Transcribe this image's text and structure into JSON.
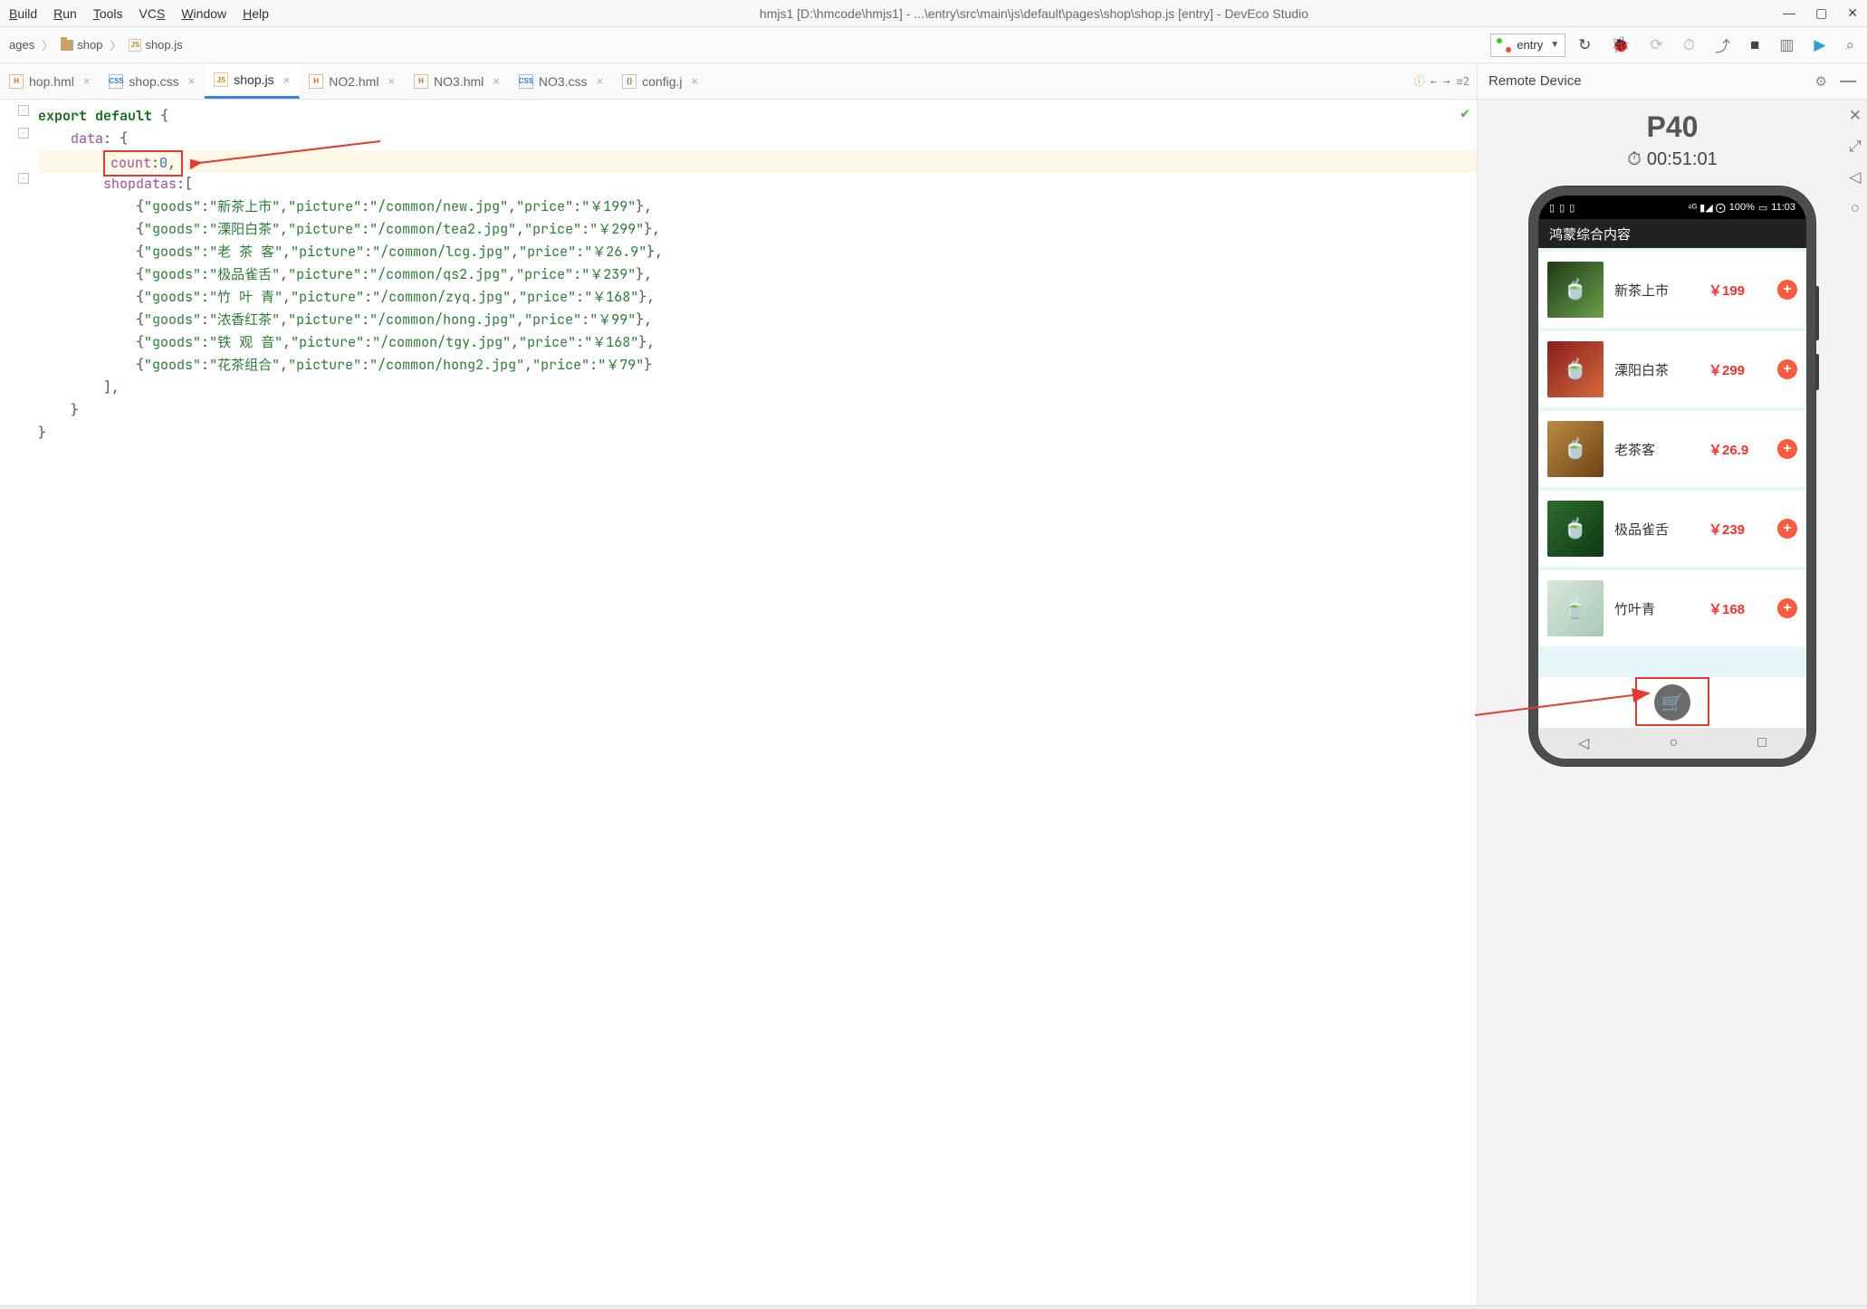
{
  "window": {
    "title": "hmjs1 [D:\\hmcode\\hmjs1] - ...\\entry\\src\\main\\js\\default\\pages\\shop\\shop.js [entry] - DevEco Studio"
  },
  "menu": {
    "items": [
      "Build",
      "Run",
      "Tools",
      "VCS",
      "Window",
      "Help"
    ],
    "underline_index": [
      0,
      0,
      0,
      -1,
      0,
      0
    ]
  },
  "breadcrumb": {
    "items": [
      "ages",
      "shop",
      "shop.js"
    ]
  },
  "run_config": {
    "label": "entry"
  },
  "editor_tabs": [
    {
      "label": "hop.hml",
      "type": "hml",
      "active": false
    },
    {
      "label": "shop.css",
      "type": "css",
      "active": false
    },
    {
      "label": "shop.js",
      "type": "js",
      "active": true
    },
    {
      "label": "NO2.hml",
      "type": "hml",
      "active": false
    },
    {
      "label": "NO3.hml",
      "type": "hml",
      "active": false
    },
    {
      "label": "NO3.css",
      "type": "css",
      "active": false
    },
    {
      "label": "config.j",
      "type": "json",
      "active": false
    }
  ],
  "tabs_extra": "←  →  ≡2",
  "code": {
    "export": "export default",
    "data": "data",
    "count": "count",
    "count_val": "0",
    "shopdatas": "shopdatas",
    "rows": [
      {
        "goods": "新茶上市",
        "picture": "/common/new.jpg",
        "price": "￥199"
      },
      {
        "goods": "溧阳白茶",
        "picture": "/common/tea2.jpg",
        "price": "￥299"
      },
      {
        "goods": "老 茶 客",
        "picture": "/common/lcg.jpg",
        "price": "￥26.9"
      },
      {
        "goods": "极品雀舌",
        "picture": "/common/qs2.jpg",
        "price": "￥239"
      },
      {
        "goods": "竹 叶 青",
        "picture": "/common/zyq.jpg",
        "price": "￥168"
      },
      {
        "goods": "浓香红茶",
        "picture": "/common/hong.jpg",
        "price": "￥99"
      },
      {
        "goods": "铁 观 音",
        "picture": "/common/tgy.jpg",
        "price": "￥168"
      },
      {
        "goods": "花茶组合",
        "picture": "/common/hong2.jpg",
        "price": "￥79"
      }
    ]
  },
  "device": {
    "panel_title": "Remote Device",
    "model": "P40",
    "timer": "00:51:01",
    "statusbar": {
      "left": "▯ ▯ ▯",
      "signal": "⁴ᴳ ▮◢ ⨀",
      "battery": "100%",
      "time": "11:03"
    },
    "app_title": "鸿蒙综合内容",
    "shoplist": [
      {
        "goods": "新茶上市",
        "price": "￥199"
      },
      {
        "goods": "溧阳白茶",
        "price": "￥299"
      },
      {
        "goods": "老茶客",
        "price": "￥26.9"
      },
      {
        "goods": "极品雀舌",
        "price": "￥239"
      },
      {
        "goods": "竹叶青",
        "price": "￥168"
      }
    ]
  }
}
